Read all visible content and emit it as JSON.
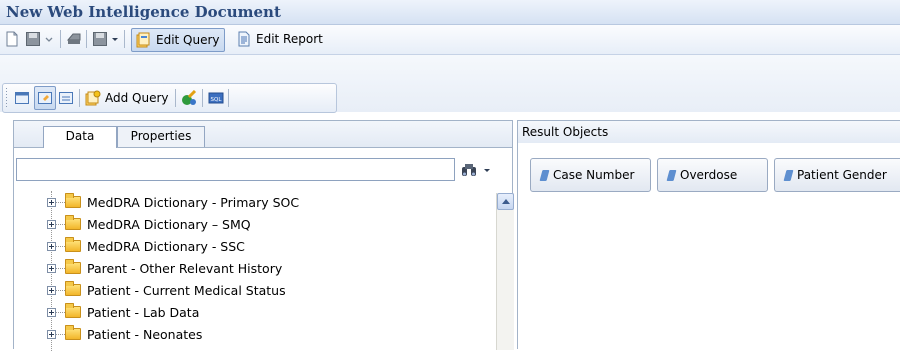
{
  "window": {
    "title": "New Web Intelligence Document"
  },
  "toolbar1": {
    "edit_query_label": "Edit Query",
    "edit_report_label": "Edit Report"
  },
  "toolbar2": {
    "add_query_label": "Add Query",
    "sql_label": "SQL"
  },
  "left_panel": {
    "tabs": [
      {
        "label": "Data",
        "active": true
      },
      {
        "label": "Properties",
        "active": false
      }
    ],
    "search": {
      "value": "",
      "placeholder": ""
    },
    "tree_items": [
      {
        "label": "MedDRA Dictionary - Primary SOC"
      },
      {
        "label": "MedDRA Dictionary – SMQ"
      },
      {
        "label": "MedDRA Dictionary - SSC"
      },
      {
        "label": "Parent - Other Relevant History"
      },
      {
        "label": "Patient - Current Medical Status"
      },
      {
        "label": "Patient - Lab Data"
      },
      {
        "label": "Patient - Neonates"
      }
    ]
  },
  "right_panel": {
    "header": "Result Objects",
    "result_objects": [
      {
        "label": "Case Number"
      },
      {
        "label": "Overdose"
      },
      {
        "label": "Patient Gender"
      }
    ]
  },
  "colors": {
    "title_text": "#2b4a7c",
    "dimension_icon": "#5e8fd0",
    "folder": "#f2b62a"
  }
}
